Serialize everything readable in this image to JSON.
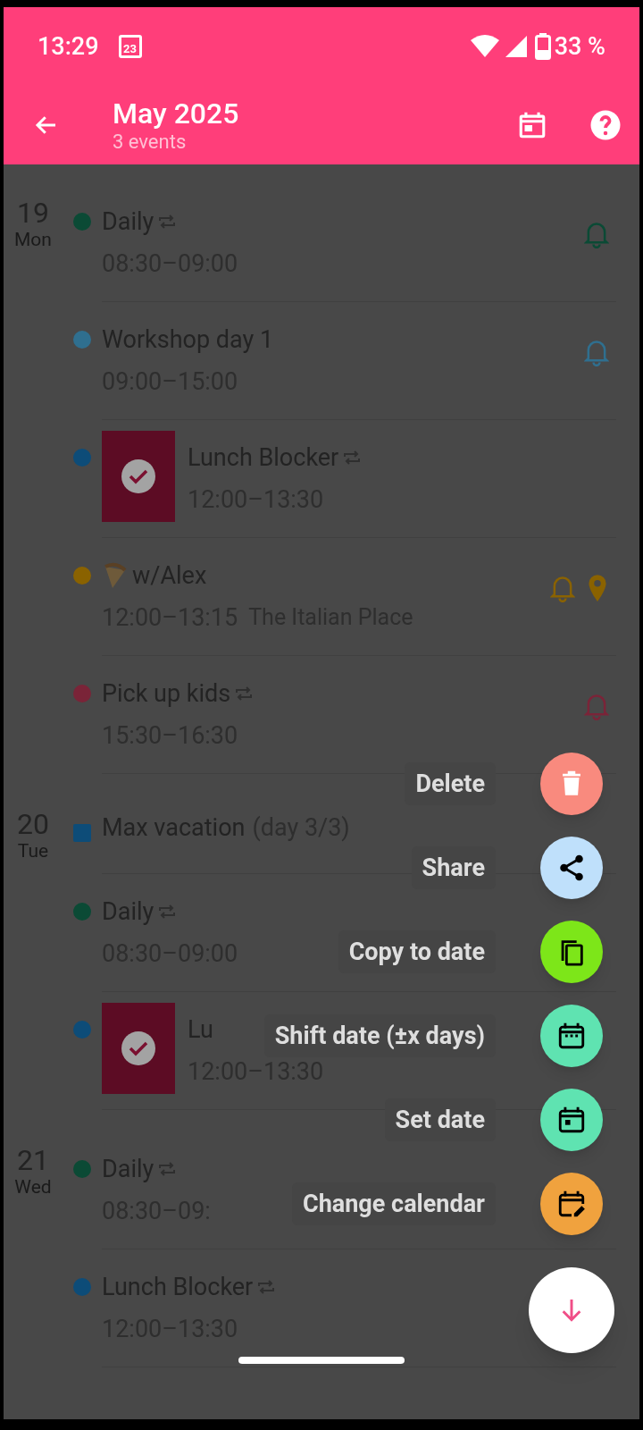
{
  "status_bar": {
    "time": "13:29",
    "notification_day": "23",
    "battery": "33 %"
  },
  "toolbar": {
    "title": "May 2025",
    "subtitle": "3 events"
  },
  "days": [
    {
      "day": "19",
      "weekday": "Mon",
      "events": [
        {
          "kind": "event",
          "color": "#0b4a35",
          "title": "Daily",
          "repeating": true,
          "time": "08:30–09:00",
          "reminder": true
        },
        {
          "kind": "event",
          "color": "#2f6f8f",
          "title": "Workshop day 1",
          "repeating": false,
          "time": "09:00–15:00",
          "reminder": true
        },
        {
          "kind": "task",
          "done": true,
          "color": "#0d4c78",
          "title": "Lunch Blocker",
          "repeating": true,
          "time": "12:00–13:30",
          "reminder": false
        },
        {
          "kind": "event",
          "color": "#8a6200",
          "title_icon": {
            "kind": "pizza"
          },
          "title": "w/Alex",
          "repeating": false,
          "time": "12:00–13:15",
          "location": "The Italian Place",
          "reminder": true,
          "location_pin": true
        },
        {
          "kind": "event",
          "color": "#7a2438",
          "title": "Pick up kids",
          "repeating": true,
          "time": "15:30–16:30",
          "reminder": true
        }
      ]
    },
    {
      "day": "20",
      "weekday": "Tue",
      "events": [
        {
          "kind": "allday",
          "color": "#0d4c78",
          "title": "Max vacation",
          "suffix": "(day 3/3)"
        },
        {
          "kind": "event",
          "color": "#0b4a35",
          "title": "Daily",
          "repeating": true,
          "time": "08:30–09:00",
          "reminder": false
        },
        {
          "kind": "task",
          "done": true,
          "color": "#0d4c78",
          "title": "Lu",
          "repeating": false,
          "time": "12:00–13:30",
          "reminder": false
        }
      ]
    },
    {
      "day": "21",
      "weekday": "Wed",
      "events": [
        {
          "kind": "event",
          "color": "#0b4a35",
          "title": "Daily",
          "repeating": true,
          "time": "08:30–09:",
          "reminder": false
        },
        {
          "kind": "event",
          "color": "#0d4c78",
          "title": "Lunch Blocker",
          "repeating": true,
          "time": "12:00–13:30",
          "reminder": false
        }
      ]
    }
  ],
  "speed_dial": {
    "actions": [
      {
        "kind": "delete",
        "label": "Delete",
        "color": "#f98a7e"
      },
      {
        "kind": "share",
        "label": "Share",
        "color": "#bfe0fb"
      },
      {
        "kind": "copy",
        "label": "Copy to date",
        "color": "#7de619"
      },
      {
        "kind": "shift",
        "label": "Shift date (±x days)",
        "color": "#5fe3b1"
      },
      {
        "kind": "set",
        "label": "Set date",
        "color": "#5fe3b1"
      },
      {
        "kind": "calendar",
        "label": "Change calendar",
        "color": "#f0a23e"
      }
    ]
  }
}
